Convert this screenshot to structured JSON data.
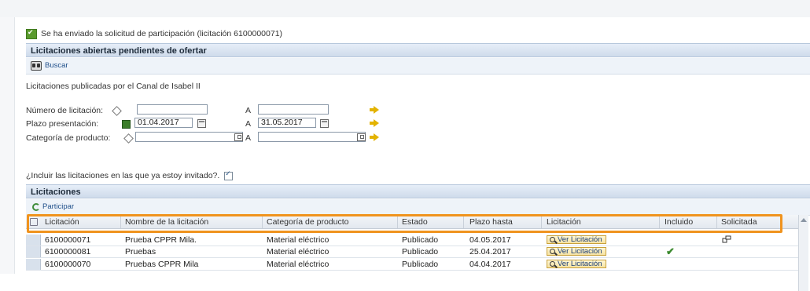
{
  "message": "Se ha enviado la solicitud de participación (licitación 6100000071)",
  "section_title": "Licitaciones abiertas pendientes de ofertar",
  "toolbar": {
    "search_label": "Buscar"
  },
  "published_by": "Licitaciones publicadas por el Canal de Isabel II",
  "filters": {
    "number_label": "Número de licitación:",
    "number_from": "",
    "number_to": "",
    "deadline_label": "Plazo presentación:",
    "deadline_from": "01.04.2017",
    "deadline_to": "31.05.2017",
    "category_label": "Categoría de producto:",
    "category_from": "",
    "category_to": "",
    "to_label": "A"
  },
  "include_invited_label": "¿Incluir las licitaciones en las que ya estoy invitado?.",
  "list_title": "Licitaciones",
  "list_toolbar": {
    "participate_label": "Participar"
  },
  "table": {
    "columns": [
      "Licitación",
      "Nombre de la licitación",
      "Categoría de producto",
      "Estado",
      "Plazo hasta",
      "Licitación",
      "Incluido",
      "Solicitada"
    ],
    "rows": [
      {
        "id": "6100000071",
        "name": "Prueba CPPR Mila.",
        "category": "Material eléctrico",
        "status": "Publicado",
        "deadline": "04.05.2017",
        "action": "Ver Licitación",
        "included": false,
        "requested": true
      },
      {
        "id": "6100000081",
        "name": "Pruebas",
        "category": "Material eléctrico",
        "status": "Publicado",
        "deadline": "25.04.2017",
        "action": "Ver Licitación",
        "included": true,
        "requested": false
      },
      {
        "id": "6100000070",
        "name": "Pruebas CPPR Mila",
        "category": "Material eléctrico",
        "status": "Publicado",
        "deadline": "04.04.2017",
        "action": "Ver Licitación",
        "included": false,
        "requested": false
      }
    ]
  },
  "highlight_color": "#f0931e",
  "icons": [
    "success-check-icon",
    "binoculars-icon",
    "calendar-icon",
    "search-arrow-icon",
    "participate-icon",
    "magnifier-icon",
    "green-check-icon",
    "requested-icon"
  ]
}
